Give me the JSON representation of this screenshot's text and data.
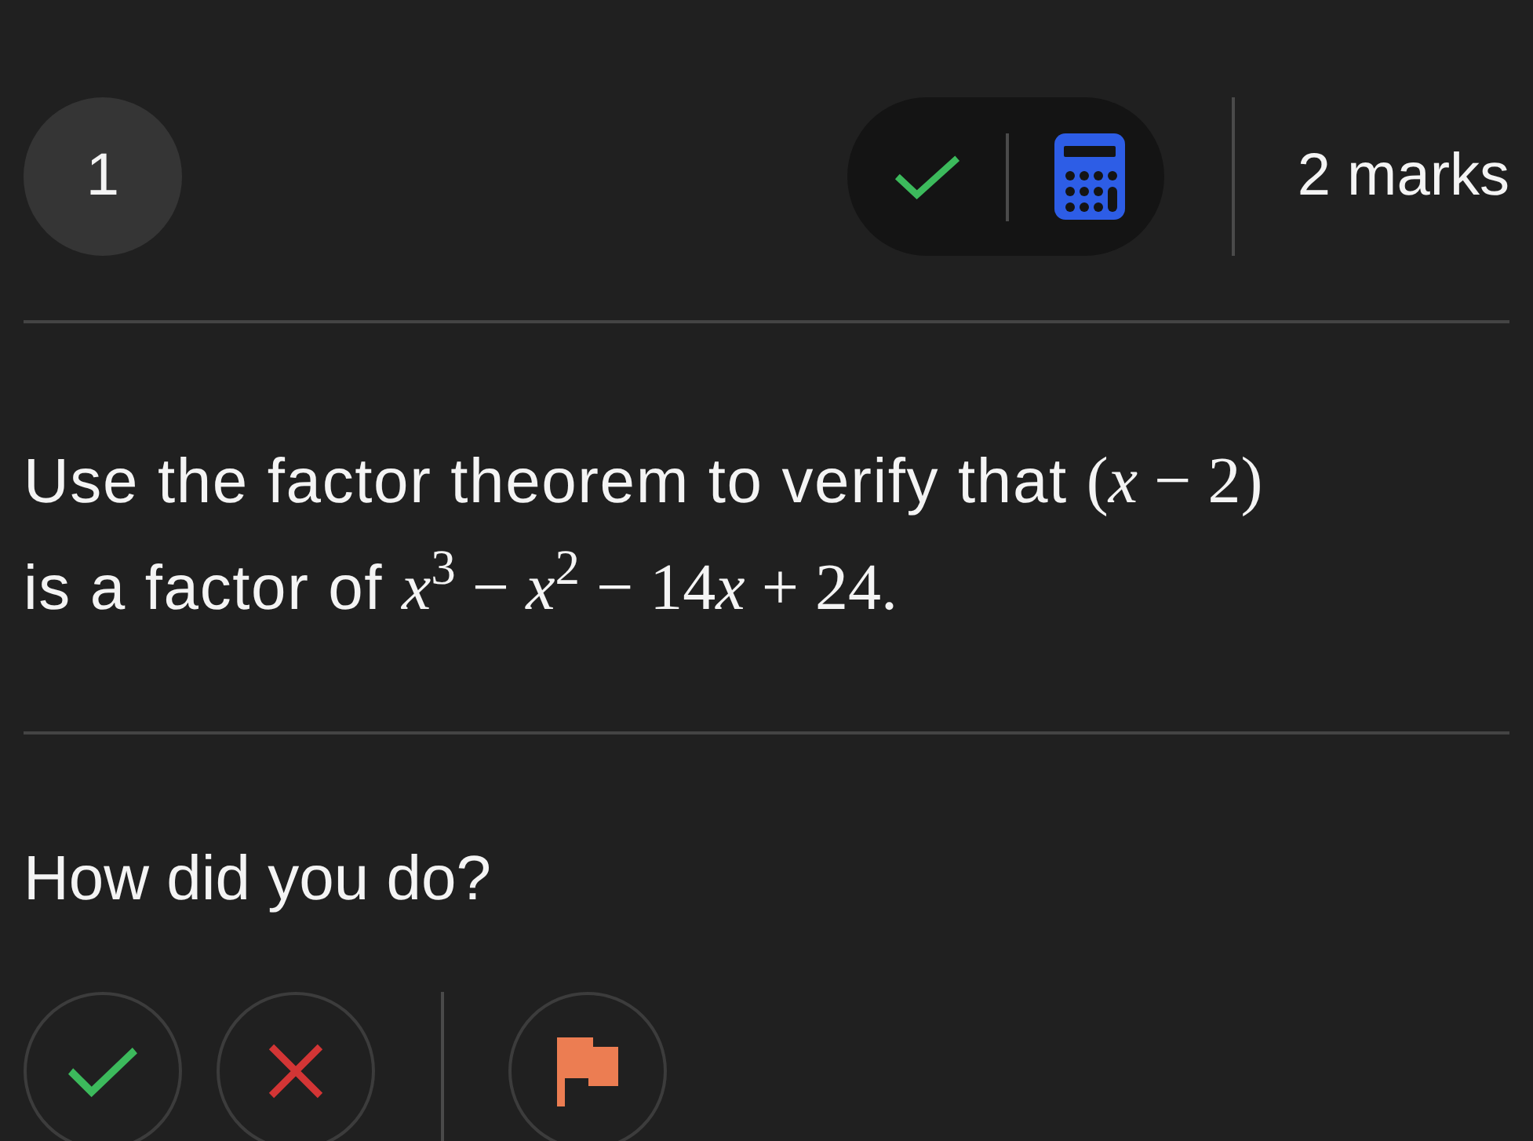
{
  "header": {
    "question_number": "1",
    "tools": [
      {
        "kind": "check"
      },
      {
        "kind": "calculator"
      }
    ],
    "marks": "2 marks"
  },
  "question": {
    "lines": [
      [
        {
          "kind": "text",
          "text": "Use the factor theorem to verify that "
        },
        {
          "kind": "math",
          "text": "(*x* − 2)"
        }
      ],
      [
        {
          "kind": "text",
          "text": "is a factor of "
        },
        {
          "kind": "math",
          "text": "*x*$^{3}$ − *x*$^{2}$ − 14"
        },
        {
          "kind": "math",
          "text": "*x* + 24."
        }
      ]
    ]
  },
  "self_assessment": {
    "prompt": "How did you do?",
    "buttons": [
      {
        "kind": "correct"
      },
      {
        "kind": "incorrect"
      },
      {
        "kind": "flag"
      }
    ]
  }
}
